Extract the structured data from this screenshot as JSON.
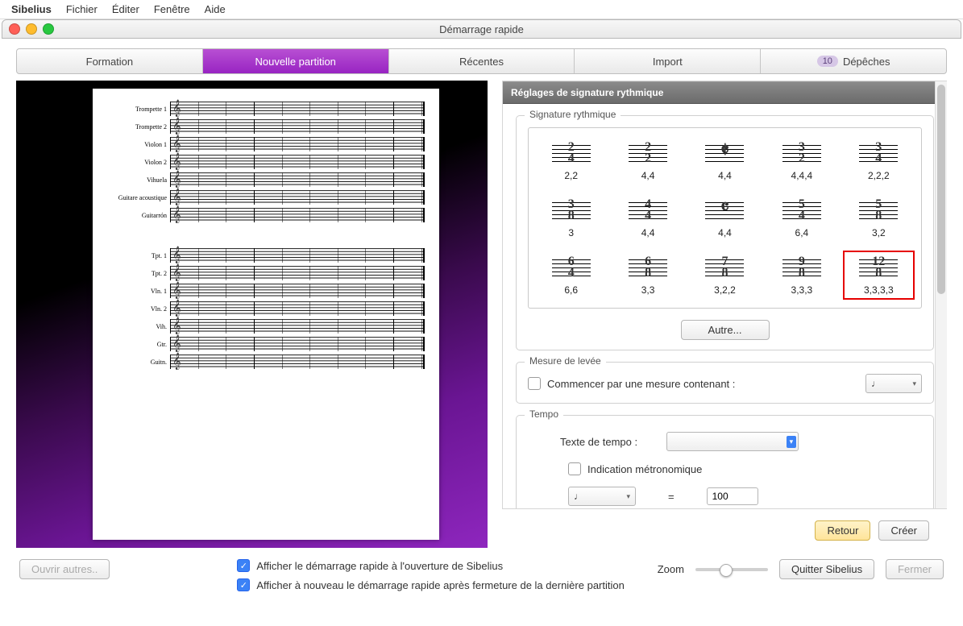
{
  "menubar": {
    "app": "Sibelius",
    "items": [
      "Fichier",
      "Éditer",
      "Fenêtre",
      "Aide"
    ]
  },
  "window": {
    "title": "Démarrage rapide"
  },
  "tabs": {
    "items": [
      {
        "label": "Formation"
      },
      {
        "label": "Nouvelle partition",
        "active": true
      },
      {
        "label": "Récentes"
      },
      {
        "label": "Import"
      },
      {
        "label": "Dépêches",
        "badge": "10"
      }
    ]
  },
  "preview_instruments": {
    "system1": [
      "Trompette 1",
      "Trompette 2",
      "Violon 1",
      "Violon 2",
      "Vihuela",
      "Guitare acoustique",
      "Guitarrón"
    ],
    "system2": [
      "Tpt. 1",
      "Tpt. 2",
      "Vln. 1",
      "Vln. 2",
      "Vih.",
      "Gtr.",
      "Guitn."
    ]
  },
  "panel": {
    "heading": "Réglages de signature rythmique",
    "group_sig": "Signature rythmique",
    "other_btn": "Autre...",
    "time_sigs": [
      {
        "top": "2",
        "bot": "4",
        "label": "2,2"
      },
      {
        "top": "2",
        "bot": "2",
        "label": "4,4"
      },
      {
        "sym": "𝄵",
        "label": "4,4"
      },
      {
        "top": "3",
        "bot": "2",
        "label": "4,4,4"
      },
      {
        "top": "3",
        "bot": "4",
        "label": "2,2,2"
      },
      {
        "top": "3",
        "bot": "8",
        "label": "3"
      },
      {
        "top": "4",
        "bot": "4",
        "label": "4,4"
      },
      {
        "sym": "𝄴",
        "label": "4,4"
      },
      {
        "top": "5",
        "bot": "4",
        "label": "6,4"
      },
      {
        "top": "5",
        "bot": "8",
        "label": "3,2"
      },
      {
        "top": "6",
        "bot": "4",
        "label": "6,6"
      },
      {
        "top": "6",
        "bot": "8",
        "label": "3,3"
      },
      {
        "top": "7",
        "bot": "8",
        "label": "3,2,2"
      },
      {
        "top": "9",
        "bot": "8",
        "label": "3,3,3"
      },
      {
        "top": "12",
        "bot": "8",
        "label": "3,3,3,3",
        "selected": true
      }
    ],
    "group_pickup": "Mesure de levée",
    "pickup_chk": "Commencer par une mesure contenant :",
    "pickup_value": "♩",
    "group_tempo": "Tempo",
    "tempo_text_label": "Texte de tempo :",
    "metronome_chk": "Indication métronomique",
    "metronome_note": "♩",
    "metronome_eq": "=",
    "metronome_val": "100"
  },
  "footer": {
    "back": "Retour",
    "create": "Créer",
    "open_others": "Ouvrir autres..",
    "chk1": "Afficher le démarrage rapide à l'ouverture de Sibelius",
    "chk2": "Afficher à nouveau le démarrage rapide après fermeture de la dernière partition",
    "zoom": "Zoom",
    "quit": "Quitter Sibelius",
    "close": "Fermer"
  }
}
